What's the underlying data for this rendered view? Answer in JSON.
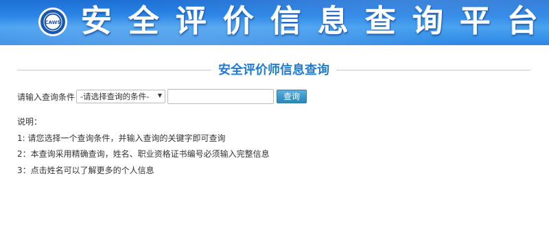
{
  "banner": {
    "logo_text": "CAWS",
    "title": "安全评价信息查询平台",
    "colors": {
      "background": "#2b86e6",
      "title_text": "#ffffff"
    }
  },
  "section": {
    "title": "安全评价师信息查询",
    "title_color": "#1f7ad1"
  },
  "search": {
    "label": "请输入查询条件",
    "select_value": "-请选择查询的条件-",
    "input_value": "",
    "button_label": "查询"
  },
  "notes": {
    "heading": "说明：",
    "items": [
      "1: 请您选择一个查询条件，并输入查询的关键字即可查询",
      "2：本查询采用精确查询，姓名、职业资格证书编号必须输入完整信息",
      "3：点击姓名可以了解更多的个人信息"
    ]
  }
}
